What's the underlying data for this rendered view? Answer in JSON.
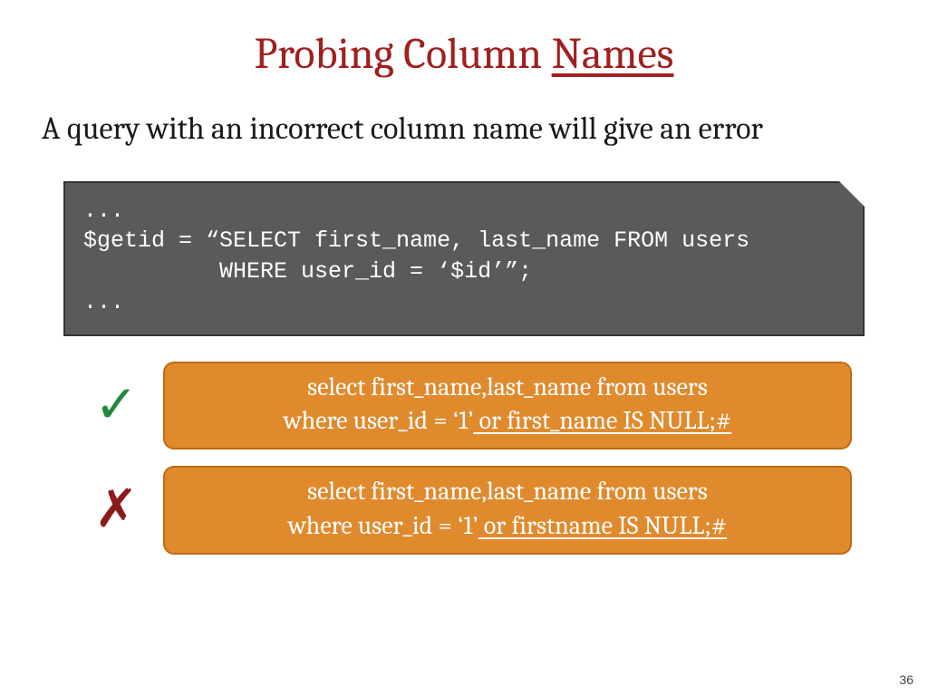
{
  "title": {
    "plain": "Probing Column ",
    "underlined": "Names"
  },
  "subtitle": "A query with an incorrect column name will give an error",
  "codebox": {
    "line1": "...",
    "line2": "$getid = “SELECT first_name, last_name FROM users",
    "line3": "          WHERE user_id = ‘$id’”;",
    "line4": "..."
  },
  "queries": {
    "good": {
      "mark": "✓",
      "l1": "select first_name,last_name from users",
      "l2_plain": "where user_id = ‘1’",
      "l2_inject": " or first_name IS NULL;#"
    },
    "bad": {
      "mark": "✗",
      "l1": "select first_name,last_name from users",
      "l2_plain": "where user_id = ‘1’",
      "l2_inject": " or firstname IS NULL;#"
    }
  },
  "page_number": "36"
}
